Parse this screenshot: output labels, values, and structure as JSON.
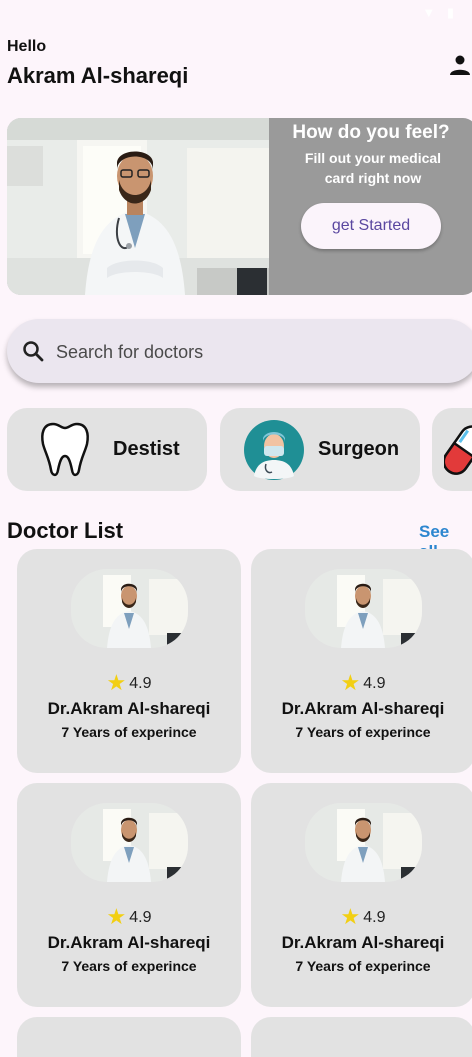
{
  "greeting": "Hello",
  "user_name": "Akram Al-shareqi",
  "banner": {
    "title": "How do you feel?",
    "subtitle_line1": "Fill out your medical",
    "subtitle_line2": "card right now",
    "button_label": "get Started"
  },
  "search": {
    "placeholder": "Search for doctors"
  },
  "categories": [
    {
      "label": "Destist",
      "icon": "tooth-icon"
    },
    {
      "label": "Surgeon",
      "icon": "surgeon-icon"
    },
    {
      "label": "",
      "icon": "pill-icon"
    }
  ],
  "doctor_list": {
    "title": "Doctor List",
    "see_all": "See all",
    "doctors": [
      {
        "rating": "4.9",
        "name": "Dr.Akram Al-shareqi",
        "experience": "7 Years of experince"
      },
      {
        "rating": "4.9",
        "name": "Dr.Akram Al-shareqi",
        "experience": "7 Years of experince"
      },
      {
        "rating": "4.9",
        "name": "Dr.Akram Al-shareqi",
        "experience": "7 Years of experince"
      },
      {
        "rating": "4.9",
        "name": "Dr.Akram Al-shareqi",
        "experience": "7 Years of experince"
      }
    ]
  },
  "colors": {
    "background": "#fdf5fb",
    "banner": "#9a9a9a",
    "card": "#e2e2e2",
    "accent_link": "#2d86cf",
    "button_text": "#5a47a0",
    "star": "#f2cf13"
  }
}
